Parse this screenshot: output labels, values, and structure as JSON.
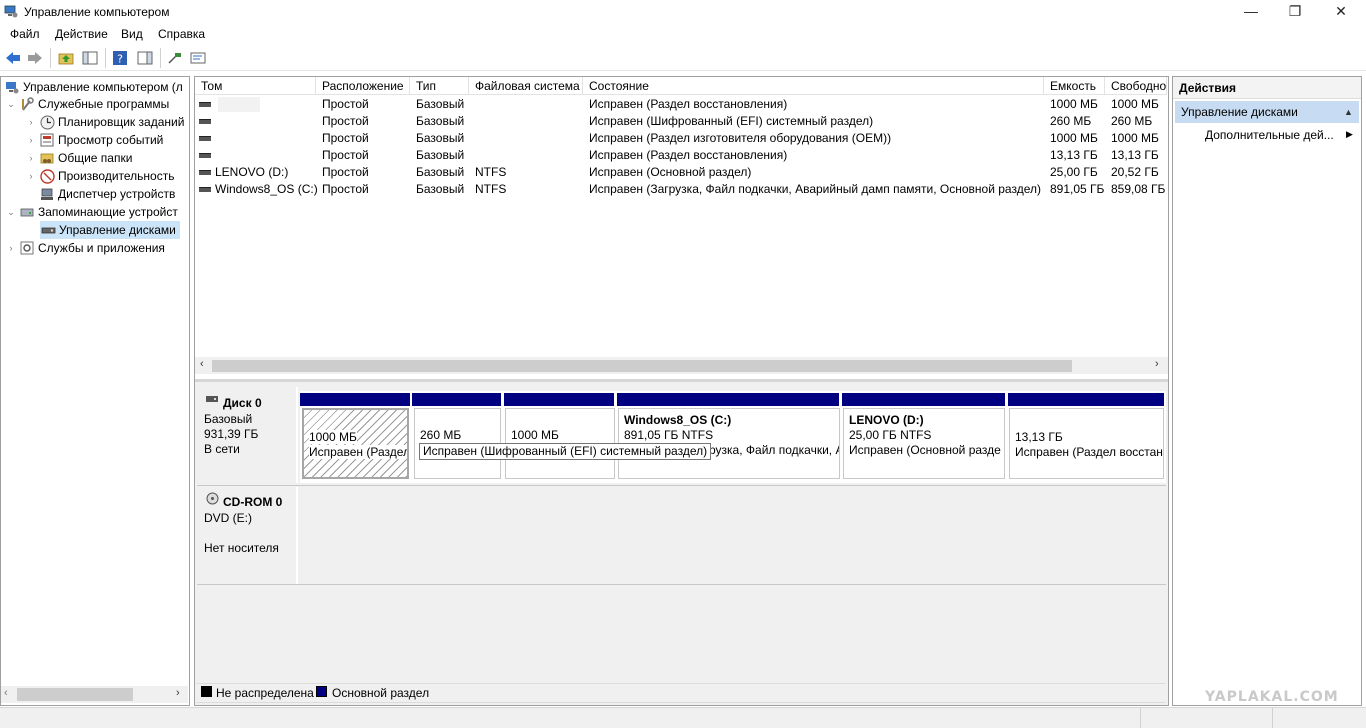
{
  "window": {
    "title": "Управление компьютером",
    "minimize": "—",
    "maximize": "❐",
    "close": "✕"
  },
  "menu": [
    "Файл",
    "Действие",
    "Вид",
    "Справка"
  ],
  "tree": {
    "root": "Управление компьютером (л",
    "items": [
      {
        "label": "Служебные программы",
        "icon": "tools-icon"
      },
      {
        "label": "Планировщик заданий",
        "icon": "clock-icon"
      },
      {
        "label": "Просмотр событий",
        "icon": "event-viewer-icon"
      },
      {
        "label": "Общие папки",
        "icon": "shared-folder-icon"
      },
      {
        "label": "Производительность",
        "icon": "performance-icon"
      },
      {
        "label": "Диспетчер устройств",
        "icon": "device-manager-icon"
      },
      {
        "label": "Запоминающие устройст",
        "icon": "storage-icon"
      },
      {
        "label": "Управление дисками",
        "icon": "disk-management-icon"
      },
      {
        "label": "Службы и приложения",
        "icon": "services-icon"
      }
    ]
  },
  "volumes": {
    "columns": [
      "Том",
      "Расположение",
      "Тип",
      "Файловая система",
      "Состояние",
      "Емкость",
      "Свободно"
    ],
    "rows": [
      {
        "name": "",
        "layout": "Простой",
        "type": "Базовый",
        "fs": "",
        "status": "Исправен (Раздел восстановления)",
        "capacity": "1000 МБ",
        "free": "1000 МБ"
      },
      {
        "name": "",
        "layout": "Простой",
        "type": "Базовый",
        "fs": "",
        "status": "Исправен (Шифрованный (EFI) системный раздел)",
        "capacity": "260 МБ",
        "free": "260 МБ"
      },
      {
        "name": "",
        "layout": "Простой",
        "type": "Базовый",
        "fs": "",
        "status": "Исправен (Раздел изготовителя оборудования (OEM))",
        "capacity": "1000 МБ",
        "free": "1000 МБ"
      },
      {
        "name": "",
        "layout": "Простой",
        "type": "Базовый",
        "fs": "",
        "status": "Исправен (Раздел восстановления)",
        "capacity": "13,13 ГБ",
        "free": "13,13 ГБ"
      },
      {
        "name": "LENOVO (D:)",
        "layout": "Простой",
        "type": "Базовый",
        "fs": "NTFS",
        "status": "Исправен (Основной раздел)",
        "capacity": "25,00 ГБ",
        "free": "20,52 ГБ"
      },
      {
        "name": "Windows8_OS (C:)",
        "layout": "Простой",
        "type": "Базовый",
        "fs": "NTFS",
        "status": "Исправен (Загрузка, Файл подкачки, Аварийный дамп памяти, Основной раздел)",
        "capacity": "891,05 ГБ",
        "free": "859,08 ГБ"
      }
    ]
  },
  "disks": {
    "disk0": {
      "name": "Диск 0",
      "type": "Базовый",
      "size": "931,39 ГБ",
      "status": "В сети",
      "partitions": [
        {
          "title": "",
          "size": "1000 МБ",
          "status": "Исправен (Раздел"
        },
        {
          "title": "",
          "size": "260 МБ",
          "status": ""
        },
        {
          "title": "",
          "size": "1000 МБ",
          "status": ""
        },
        {
          "title": "Windows8_OS  (C:)",
          "size": "891,05 ГБ NTFS",
          "status": "рузка, Файл подкачки, А"
        },
        {
          "title": "LENOVO  (D:)",
          "size": "25,00 ГБ NTFS",
          "status": "Исправен (Основной разде"
        },
        {
          "title": "",
          "size": "13,13 ГБ",
          "status": "Исправен (Раздел восстан"
        }
      ]
    },
    "cdrom": {
      "name": "CD-ROM 0",
      "drive": "DVD (E:)",
      "status": "Нет носителя"
    },
    "tooltip": "Исправен (Шифрованный (EFI) системный раздел)"
  },
  "legend": {
    "unallocated": "Не распределена",
    "primary": "Основной раздел",
    "unallocated_color": "#000000",
    "primary_color": "#000080"
  },
  "actions": {
    "header": "Действия",
    "section": "Управление дисками",
    "more": "Дополнительные дей..."
  },
  "watermark": "YAPLAKAL.COM"
}
